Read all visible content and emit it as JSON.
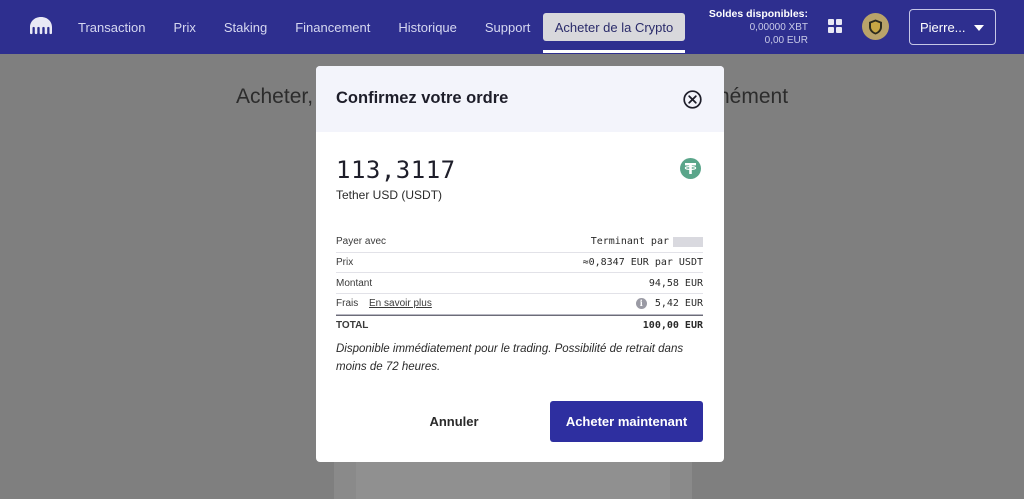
{
  "nav": {
    "items": [
      "Transaction",
      "Prix",
      "Staking",
      "Financement",
      "Historique",
      "Support"
    ],
    "buy_tab": "Acheter de la Crypto",
    "balances": {
      "title": "Soldes disponibles:",
      "xbt": "0,00000 XBT",
      "eur": "0,00 EUR"
    },
    "user": "Pierre..."
  },
  "page": {
    "heading_left": "Acheter,",
    "heading_right": "nément"
  },
  "modal": {
    "title": "Confirmez votre ordre",
    "amount": "113,3117",
    "currency": "Tether USD (USDT)",
    "rows": {
      "pay_label": "Payer avec",
      "pay_value": "Terminant par",
      "price_label": "Prix",
      "price_value": "≈0,8347 EUR par USDT",
      "amount_label": "Montant",
      "amount_value": "94,58 EUR",
      "fees_label": "Frais",
      "fees_link": "En savoir plus",
      "fees_value": "5,42 EUR",
      "total_label": "TOTAL",
      "total_value": "100,00 EUR"
    },
    "note": "Disponible immédiatement pour le trading. Possibilité de retrait dans moins de 72 heures.",
    "cancel": "Annuler",
    "confirm": "Acheter maintenant"
  },
  "colors": {
    "nav_bg": "#2e2f8f",
    "primary_button": "#2e2fa0",
    "tether_green": "#5aa58a"
  }
}
